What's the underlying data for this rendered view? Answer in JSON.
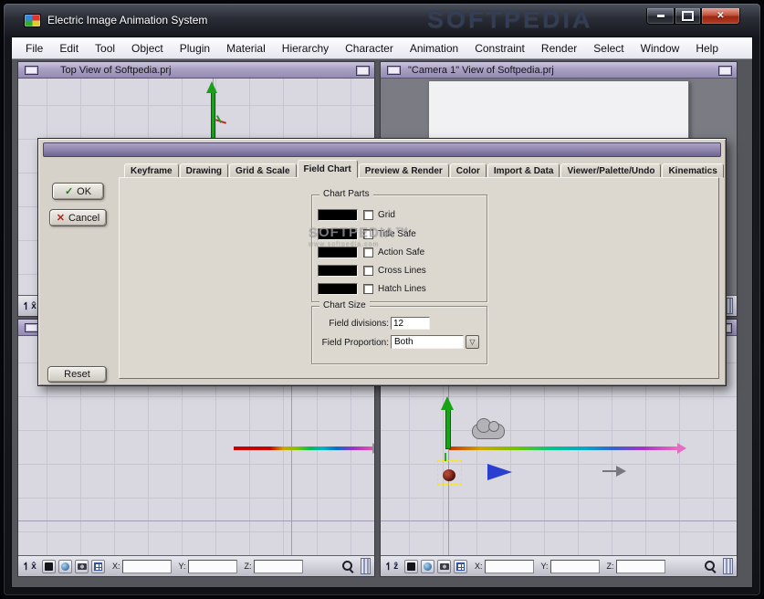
{
  "window": {
    "title": "Electric Image Animation System",
    "watermark": "SOFTPEDIA"
  },
  "menu": {
    "items": [
      "File",
      "Edit",
      "Tool",
      "Object",
      "Plugin",
      "Material",
      "Hierarchy",
      "Character",
      "Animation",
      "Constraint",
      "Render",
      "Select",
      "Window",
      "Help"
    ]
  },
  "viewports": {
    "top_left": {
      "title": "Top View of Softpedia.prj",
      "axis": "x̂"
    },
    "top_right": {
      "title": "\"Camera 1\" View of Softpedia.prj",
      "axis": ""
    },
    "bottom_left": {
      "axis": "x̂"
    },
    "bottom_right": {
      "axis": "ẑ"
    },
    "status": {
      "x": "X:",
      "y": "Y:",
      "z": "Z:"
    }
  },
  "dialog": {
    "tabs": [
      "Keyframe",
      "Drawing",
      "Grid & Scale",
      "Field Chart",
      "Preview & Render",
      "Color",
      "Import & Data",
      "Viewer/Palette/Undo",
      "Kinematics"
    ],
    "active_tab": "Field Chart",
    "ok": "OK",
    "cancel": "Cancel",
    "reset": "Reset",
    "chart_parts": {
      "title": "Chart Parts",
      "swatch_color": "#000000",
      "items": [
        "Grid",
        "Title Safe",
        "Action Safe",
        "Cross Lines",
        "Hatch Lines"
      ]
    },
    "chart_size": {
      "title": "Chart Size",
      "field_divisions_label": "Field divisions:",
      "field_divisions_value": "12",
      "field_proportion_label": "Field Proportion:",
      "field_proportion_value": "Both"
    },
    "watermark": {
      "line1": "SOFTPEDIA™",
      "line2": "www.softpedia.com"
    }
  }
}
